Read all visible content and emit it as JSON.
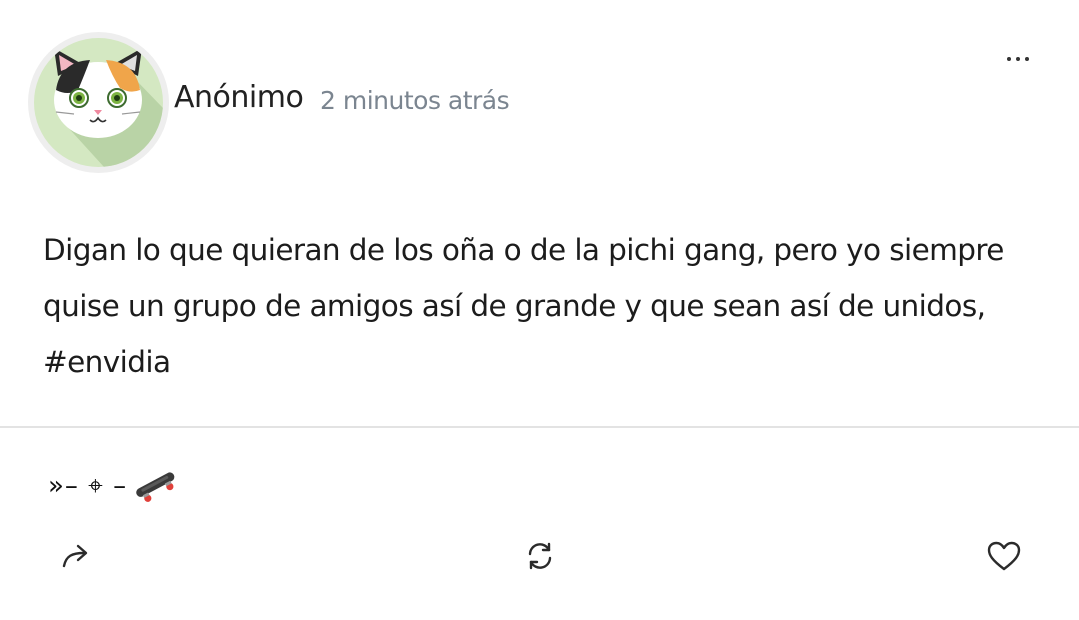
{
  "post": {
    "author": "Anónimo",
    "timestamp": "2 minutos atrás",
    "body_line1": "Digan lo que quieran de los oña o de la pichi gang, pero yo siempre",
    "body_line2": "quise un grupo de amigos así de grande y que sean así de unidos,",
    "hashtag": "#envidia",
    "signature": "»– ⌖ –",
    "signature_emoji": "skateboard"
  },
  "avatar": {
    "icon": "calico-cat-icon",
    "background": "#d4e8c2"
  },
  "actions": {
    "share_icon": "share-icon",
    "repost_icon": "repost-icon",
    "like_icon": "heart-icon"
  }
}
